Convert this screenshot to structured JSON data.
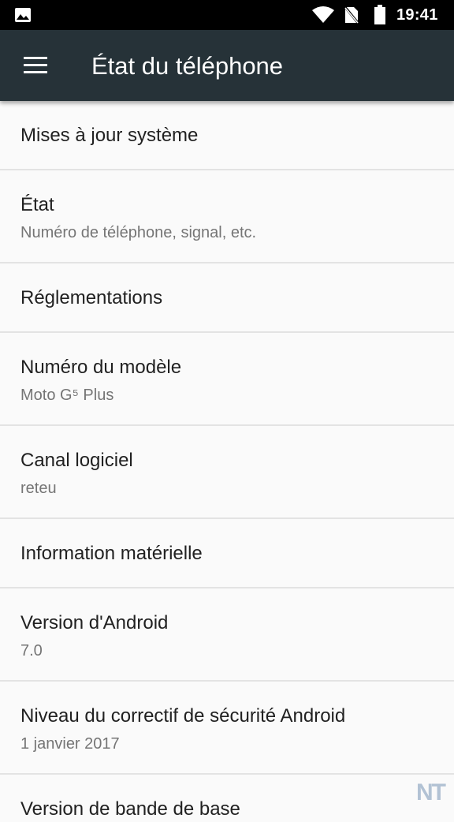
{
  "status_bar": {
    "time": "19:41",
    "icons": [
      "image-icon",
      "wifi-icon",
      "no-sim-icon",
      "battery-icon"
    ]
  },
  "toolbar": {
    "title": "État du téléphone",
    "menu_icon": "hamburger-menu-icon"
  },
  "items": [
    {
      "title": "Mises à jour système"
    },
    {
      "title": "État",
      "subtitle": "Numéro de téléphone, signal, etc."
    },
    {
      "title": "Réglementations"
    },
    {
      "title": "Numéro du modèle",
      "subtitle": "Moto G⁵ Plus"
    },
    {
      "title": "Canal logiciel",
      "subtitle": "reteu"
    },
    {
      "title": "Information matérielle"
    },
    {
      "title": "Version d'Android",
      "subtitle": "7.0"
    },
    {
      "title": "Niveau du correctif de sécurité Android",
      "subtitle": "1 janvier 2017"
    },
    {
      "title": "Version de bande de base"
    }
  ],
  "watermark": "NT",
  "colors": {
    "toolbar": "#263238",
    "background": "#fafafa",
    "primary_text": "#212121",
    "secondary_text": "#757575"
  }
}
